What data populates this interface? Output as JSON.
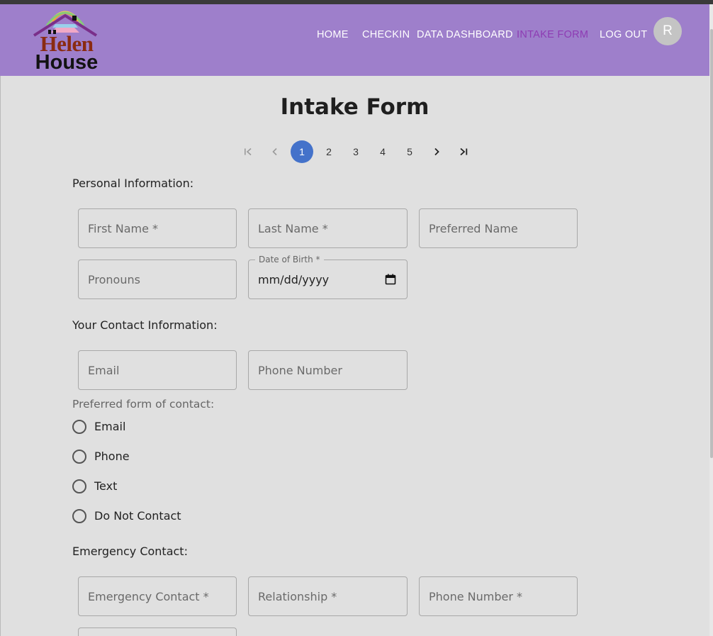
{
  "app": {
    "logo_line1": "Helen",
    "logo_line2": "House"
  },
  "nav": {
    "items": [
      {
        "label": "HOME",
        "active": false
      },
      {
        "label": "CHECKIN",
        "active": false
      },
      {
        "label": "DATA DASHBOARD",
        "active": false
      },
      {
        "label": "INTAKE FORM",
        "active": true
      },
      {
        "label": "LOG OUT",
        "active": false
      }
    ],
    "avatar_initial": "R"
  },
  "page": {
    "title": "Intake Form"
  },
  "pagination": {
    "pages": [
      "1",
      "2",
      "3",
      "4",
      "5"
    ],
    "current": "1",
    "first_icon": "first-page-icon",
    "prev_icon": "chevron-left-icon",
    "next_icon": "chevron-right-icon",
    "last_icon": "last-page-icon"
  },
  "sections": {
    "personal": {
      "label": "Personal Information:",
      "fields": {
        "first_name": "First Name *",
        "last_name": "Last Name *",
        "preferred_name": "Preferred Name",
        "pronouns": "Pronouns",
        "dob_label": "Date of Birth *",
        "dob_value": "mm/dd/yyyy"
      }
    },
    "contact": {
      "label": "Your Contact Information:",
      "fields": {
        "email": "Email",
        "phone": "Phone Number"
      },
      "preferred_label": "Preferred form of contact:",
      "options": [
        "Email",
        "Phone",
        "Text",
        "Do Not Contact"
      ]
    },
    "emergency": {
      "label": "Emergency Contact:",
      "fields": {
        "contact": "Emergency Contact *",
        "relationship": "Relationship *",
        "phone": "Phone Number *"
      }
    }
  },
  "colors": {
    "navbar": "#9e7fcb",
    "active_nav": "#8e3bb3",
    "pager_selected": "#4472ca",
    "background": "#e0e0e0"
  }
}
